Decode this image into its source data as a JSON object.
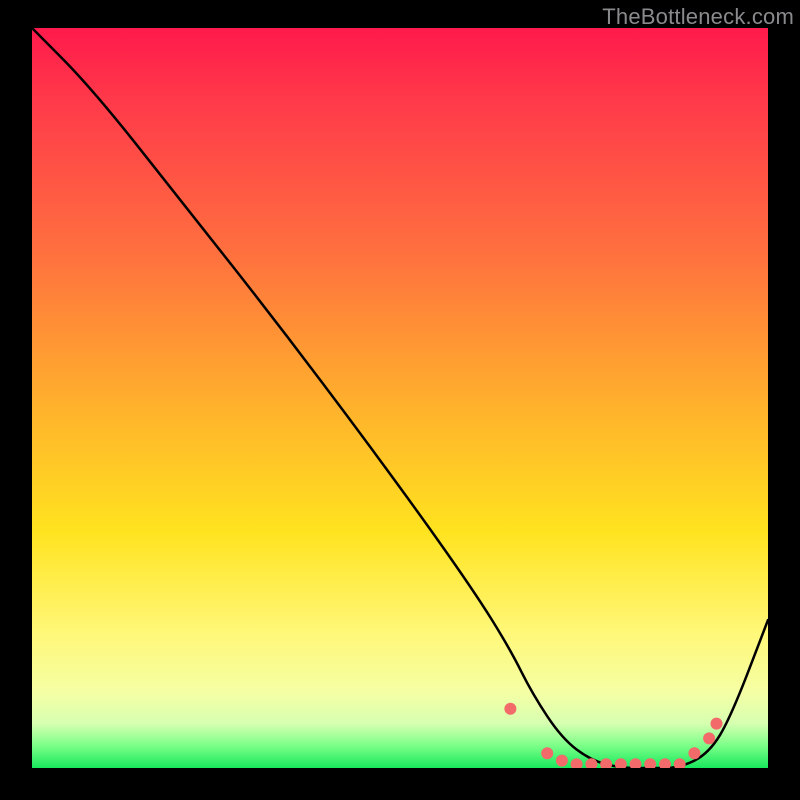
{
  "watermark": "TheBottleneck.com",
  "chart_data": {
    "type": "line",
    "title": "",
    "xlabel": "",
    "ylabel": "",
    "xlim": [
      0,
      100
    ],
    "ylim": [
      0,
      100
    ],
    "grid": false,
    "legend": false,
    "background_gradient": [
      "#ff1a4b",
      "#ff6f3f",
      "#ffe31f",
      "#f4ffa5",
      "#18e85c"
    ],
    "series": [
      {
        "name": "curve",
        "color": "#000000",
        "x": [
          0,
          8,
          20,
          35,
          50,
          60,
          65,
          68,
          72,
          76,
          80,
          84,
          88,
          92,
          95,
          100
        ],
        "y": [
          100,
          92,
          77,
          58,
          38,
          24,
          16,
          10,
          4,
          1,
          0,
          0,
          0,
          2,
          7,
          20
        ]
      }
    ],
    "markers": {
      "name": "highlight-dots",
      "color": "#f26a6a",
      "radius": 6,
      "x": [
        65,
        70,
        72,
        74,
        76,
        78,
        80,
        82,
        84,
        86,
        88,
        90,
        92,
        93
      ],
      "y": [
        8,
        2,
        1,
        0.5,
        0.5,
        0.5,
        0.5,
        0.5,
        0.5,
        0.5,
        0.5,
        2,
        4,
        6
      ]
    }
  }
}
